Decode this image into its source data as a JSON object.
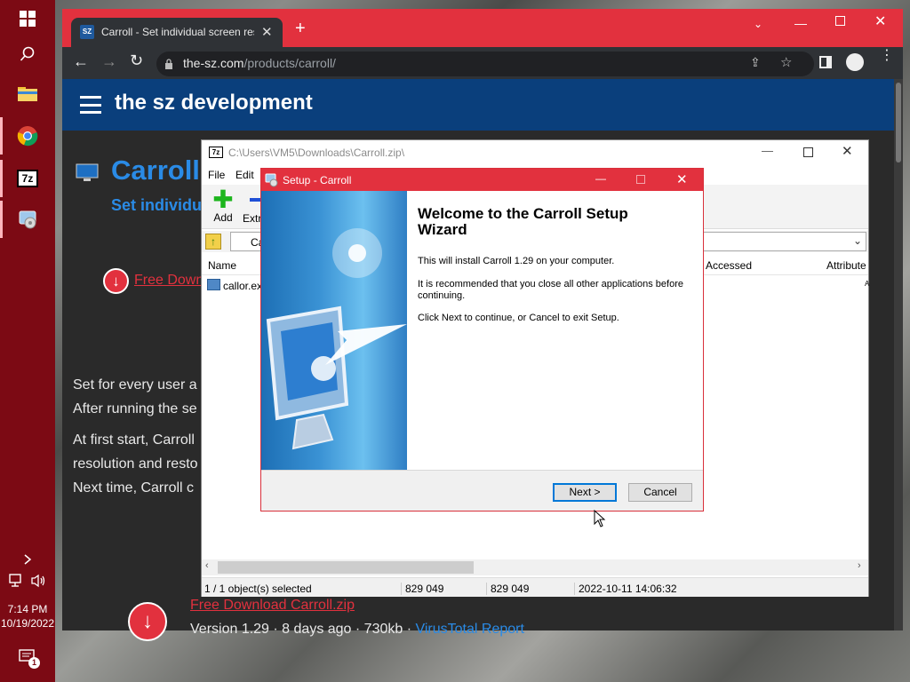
{
  "taskbar": {
    "clock_time": "7:14 PM",
    "clock_date": "10/19/2022",
    "notification_count": "1"
  },
  "browser": {
    "tab_title": "Carroll - Set individual screen res",
    "tab_favicon_text": "SZ",
    "url_domain": "the-sz.com",
    "url_path": "/products/carroll/",
    "site_title": "the sz development"
  },
  "page": {
    "heading": "Carroll",
    "subheading": "Set individu",
    "download_link_top": "Free Down",
    "para1_line1": "Set for every user a",
    "para1_line2": "After running the se",
    "para2_line1": "At first start, Carroll",
    "para2_line2": "resolution and resto",
    "para2_line3": "Next time, Carroll c",
    "download_link_bottom": "Free Download Carroll.zip",
    "version_info": "Version 1.29 · 8 days ago · 730kb · ",
    "virustotal_link": "VirusTotal Report"
  },
  "zip": {
    "title": "C:\\Users\\VM5\\Downloads\\Carroll.zip\\",
    "menu": [
      "File",
      "Edit"
    ],
    "toolbar": {
      "add": "Add",
      "extract": "Extr"
    },
    "address_prefix": "Ca",
    "columns": {
      "name": "Name",
      "accessed": "Accessed",
      "attributes": "Attribute"
    },
    "file_name": "callor.ex",
    "file_attr": "A",
    "status": {
      "selected": "1 / 1 object(s) selected",
      "size": "829 049",
      "packed": "829 049",
      "date": "2022-10-11 14:06:32"
    }
  },
  "setup": {
    "title": "Setup - Carroll",
    "heading_line1": "Welcome to the Carroll Setup",
    "heading_line2": "Wizard",
    "text1": "This will install Carroll 1.29 on your computer.",
    "text2": "It is recommended that you close all other applications before continuing.",
    "text3": "Click Next to continue, or Cancel to exit Setup.",
    "next_label": "Next >",
    "cancel_label": "Cancel"
  },
  "colors": {
    "browser_accent": "#e2313e",
    "site_header": "#0a3f7c",
    "link_red": "#e2313e",
    "link_blue": "#2a8be6",
    "taskbar": "#7c0a14"
  }
}
